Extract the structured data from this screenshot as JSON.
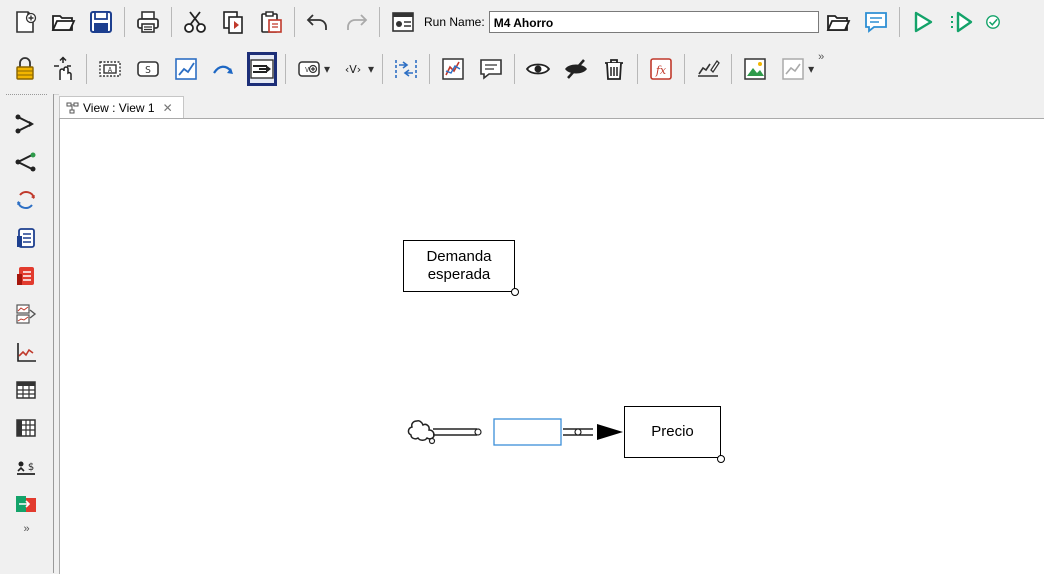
{
  "toolbar": {
    "run_name_label": "Run Name:",
    "run_name_value": "M4 Ahorro",
    "row1_icons": [
      "new-model-icon",
      "open-icon",
      "save-icon",
      "print-icon",
      "cut-icon",
      "copy-icon",
      "paste-icon",
      "undo-icon",
      "redo-icon",
      "run-settings-icon"
    ],
    "row2_icons": [
      "lock-icon",
      "move-icon",
      "box-variable-icon",
      "stock-icon",
      "line-graph-icon",
      "arrow-icon",
      "rate-icon",
      "shadow-variable-icon",
      "angle-variable-icon",
      "merge-icon",
      "graph-icon",
      "comment-icon",
      "show-icon",
      "hide-icon",
      "delete-icon",
      "function-icon",
      "sketch-icon",
      "image-icon",
      "layout-icon"
    ],
    "more_label": "»"
  },
  "sidebar": {
    "icons": [
      "causes-tree-icon",
      "uses-tree-icon",
      "loops-icon",
      "document-icon",
      "document-all-icon",
      "causes-strip-icon",
      "graph-icon",
      "table-icon",
      "table-time-down-icon",
      "runs-compare-icon",
      "sync-icon"
    ],
    "more_label": "»"
  },
  "tab": {
    "label": "View : View 1",
    "close": "✕"
  },
  "diagram": {
    "variables": [
      {
        "line1": "Demanda",
        "line2": "esperada"
      },
      {
        "line1": "Precio",
        "line2": ""
      }
    ]
  },
  "colors": {
    "selected_outline": "#1c2e78",
    "flow_valve": "#3b8fd9",
    "run_green": "#14a36a"
  }
}
